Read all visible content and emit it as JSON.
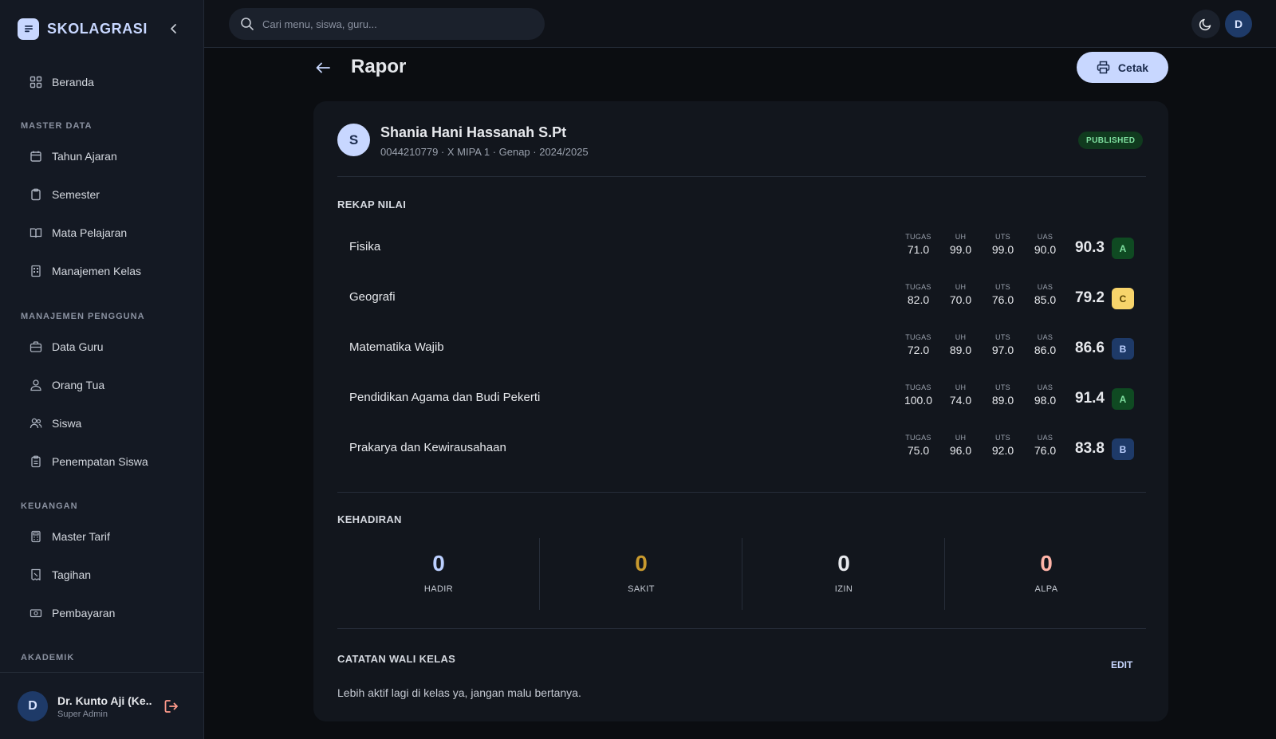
{
  "app": {
    "brand": "SKOLAGRASI"
  },
  "sidebar": {
    "home": "Beranda",
    "sections": {
      "master_data": "MASTER DATA",
      "manajemen_pengguna": "MANAJEMEN PENGGUNA",
      "keuangan": "KEUANGAN",
      "akademik": "AKADEMIK"
    },
    "items": {
      "tahun_ajaran": "Tahun Ajaran",
      "semester": "Semester",
      "mata_pelajaran": "Mata Pelajaran",
      "manajemen_kelas": "Manajemen Kelas",
      "data_guru": "Data Guru",
      "orang_tua": "Orang Tua",
      "siswa": "Siswa",
      "penempatan_siswa": "Penempatan Siswa",
      "master_tarif": "Master Tarif",
      "tagihan": "Tagihan",
      "pembayaran": "Pembayaran"
    },
    "user": {
      "initial": "D",
      "name": "Dr. Kunto Aji (Ke...",
      "role": "Super Admin"
    }
  },
  "topbar": {
    "search_placeholder": "Cari menu, siswa, guru...",
    "avatar_initial": "D"
  },
  "page": {
    "title": "Rapor",
    "print_label": "Cetak"
  },
  "student": {
    "initial": "S",
    "name": "Shania Hani Hassanah S.Pt",
    "meta": "0044210779 · X MIPA 1 · Genap · 2024/2025",
    "status": "PUBLISHED"
  },
  "grades": {
    "title": "REKAP NILAI",
    "labels": {
      "tugas": "TUGAS",
      "uh": "UH",
      "uts": "UTS",
      "uas": "UAS"
    },
    "rows": [
      {
        "subject": "Fisika",
        "tugas": "71.0",
        "uh": "99.0",
        "uts": "99.0",
        "uas": "90.0",
        "final": "90.3",
        "grade": "A"
      },
      {
        "subject": "Geografi",
        "tugas": "82.0",
        "uh": "70.0",
        "uts": "76.0",
        "uas": "85.0",
        "final": "79.2",
        "grade": "C"
      },
      {
        "subject": "Matematika Wajib",
        "tugas": "72.0",
        "uh": "89.0",
        "uts": "97.0",
        "uas": "86.0",
        "final": "86.6",
        "grade": "B"
      },
      {
        "subject": "Pendidikan Agama dan Budi Pekerti",
        "tugas": "100.0",
        "uh": "74.0",
        "uts": "89.0",
        "uas": "98.0",
        "final": "91.4",
        "grade": "A"
      },
      {
        "subject": "Prakarya dan Kewirausahaan",
        "tugas": "75.0",
        "uh": "96.0",
        "uts": "92.0",
        "uas": "76.0",
        "final": "83.8",
        "grade": "B"
      }
    ]
  },
  "attendance": {
    "title": "KEHADIRAN",
    "hadir": {
      "value": "0",
      "label": "HADIR"
    },
    "sakit": {
      "value": "0",
      "label": "SAKIT"
    },
    "izin": {
      "value": "0",
      "label": "IZIN"
    },
    "alpa": {
      "value": "0",
      "label": "ALPA"
    }
  },
  "notes": {
    "title": "CATATAN WALI KELAS",
    "edit_label": "EDIT",
    "text": "Lebih aktif lagi di kelas ya, jangan malu bertanya."
  },
  "colors": {
    "accent": "#c8d7ff",
    "grade_a_bg": "#0f4a22",
    "grade_a_fg": "#7fe0a0",
    "grade_b_bg": "#1e3a68",
    "grade_b_fg": "#bcd0ff",
    "grade_c_bg": "#f7d46b",
    "grade_c_fg": "#5a4300",
    "hadir": "#bcd0ff",
    "sakit": "#c99a2e",
    "izin": "#e6e8ec",
    "alpa": "#ffb4a8"
  }
}
